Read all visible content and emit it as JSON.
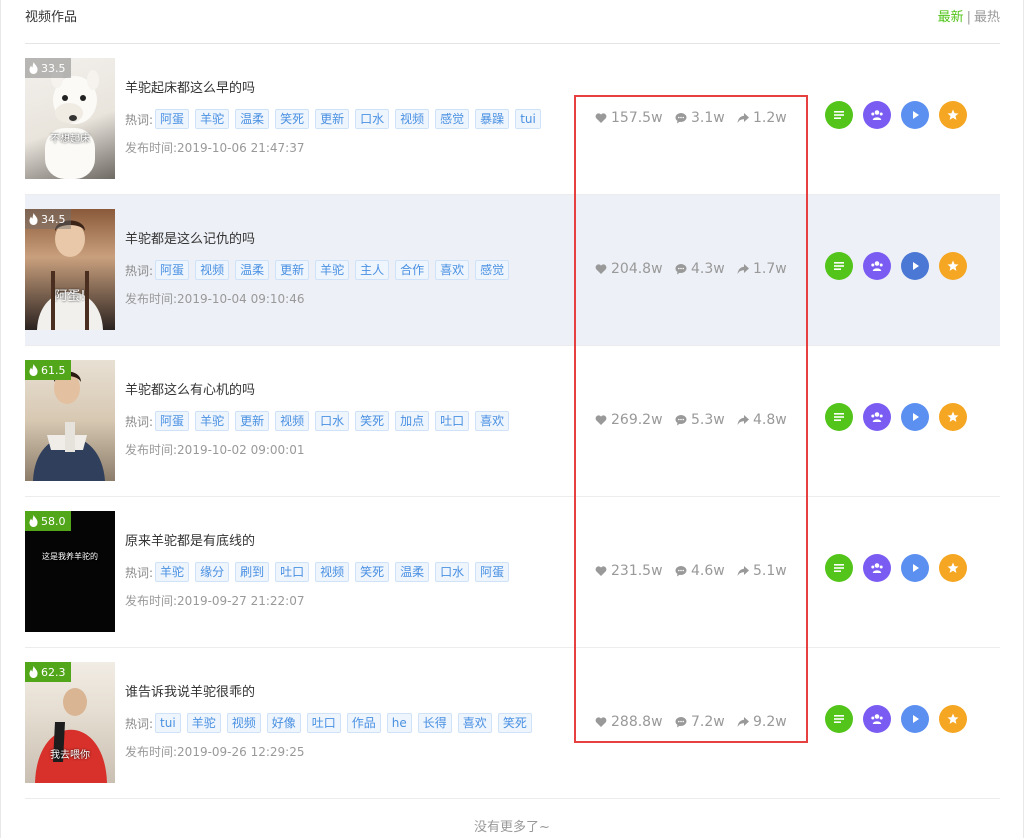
{
  "header": {
    "title": "视频作品",
    "sort_latest": "最新",
    "sort_separator": "|",
    "sort_hottest": "最热",
    "accent_color": "#52c41a"
  },
  "labels": {
    "hotwords": "热词:",
    "publish_prefix": "发布时间:"
  },
  "videos": [
    {
      "heat": "33.5",
      "heat_style": "grey",
      "thumb_caption": "不想起床",
      "title": "羊驼起床都这么早的吗",
      "tags": [
        "阿蛋",
        "羊驼",
        "温柔",
        "笑死",
        "更新",
        "口水",
        "视频",
        "感觉",
        "暴躁",
        "tui"
      ],
      "date": "2019-10-06 21:47:37",
      "likes": "157.5w",
      "comments": "3.1w",
      "shares": "1.2w"
    },
    {
      "heat": "34.5",
      "heat_style": "grey",
      "thumb_caption": "阿蛋!",
      "title": "羊驼都是这么记仇的吗",
      "tags": [
        "阿蛋",
        "视频",
        "温柔",
        "更新",
        "羊驼",
        "主人",
        "合作",
        "喜欢",
        "感觉"
      ],
      "date": "2019-10-04 09:10:46",
      "likes": "204.8w",
      "comments": "4.3w",
      "shares": "1.7w"
    },
    {
      "heat": "61.5",
      "heat_style": "green",
      "thumb_caption": "",
      "title": "羊驼都这么有心机的吗",
      "tags": [
        "阿蛋",
        "羊驼",
        "更新",
        "视频",
        "口水",
        "笑死",
        "加点",
        "吐口",
        "喜欢"
      ],
      "date": "2019-10-02 09:00:01",
      "likes": "269.2w",
      "comments": "5.3w",
      "shares": "4.8w"
    },
    {
      "heat": "58.0",
      "heat_style": "green",
      "thumb_caption": "这是我养羊驼的",
      "title": "原来羊驼都是有底线的",
      "tags": [
        "羊驼",
        "缘分",
        "刷到",
        "吐口",
        "视频",
        "笑死",
        "温柔",
        "口水",
        "阿蛋"
      ],
      "date": "2019-09-27 21:22:07",
      "likes": "231.5w",
      "comments": "4.6w",
      "shares": "5.1w"
    },
    {
      "heat": "62.3",
      "heat_style": "green",
      "thumb_caption": "我去喂你",
      "title": "谁告诉我说羊驼很乖的",
      "tags": [
        "tui",
        "羊驼",
        "视频",
        "好像",
        "吐口",
        "作品",
        "he",
        "长得",
        "喜欢",
        "笑死"
      ],
      "date": "2019-09-26 12:29:25",
      "likes": "288.8w",
      "comments": "7.2w",
      "shares": "9.2w"
    }
  ],
  "action_icons": [
    "list-icon",
    "fans-icon",
    "play-icon",
    "star-icon"
  ],
  "action_colors": [
    "#52c41a",
    "#7b5cf2",
    "#5b8ff0",
    "#f5a623"
  ],
  "footer": {
    "no_more": "没有更多了~"
  }
}
